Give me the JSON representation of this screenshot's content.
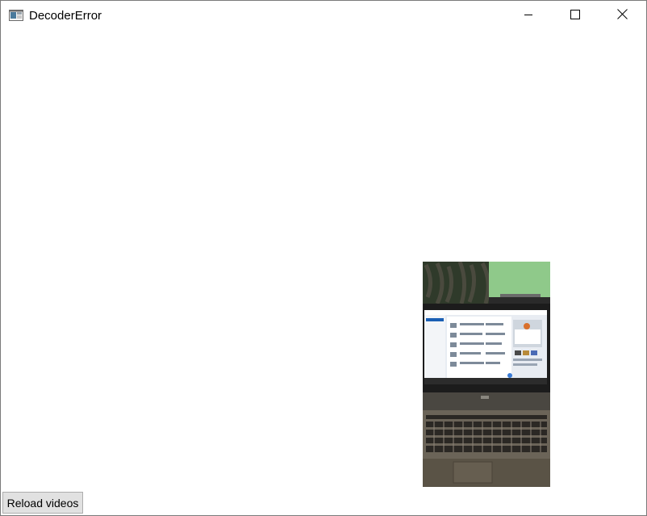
{
  "window": {
    "title": "DecoderError",
    "app_icon": "window-app-icon",
    "controls": {
      "minimize_icon": "minimize-icon",
      "maximize_icon": "maximize-icon",
      "close_icon": "close-icon"
    }
  },
  "main": {
    "video_frame": {
      "description_icon": "video-thumbnail"
    },
    "reload_button_label": "Reload videos"
  },
  "colors": {
    "background": "#ffffff",
    "button_face": "#e1e1e1",
    "button_border": "#adadad"
  }
}
